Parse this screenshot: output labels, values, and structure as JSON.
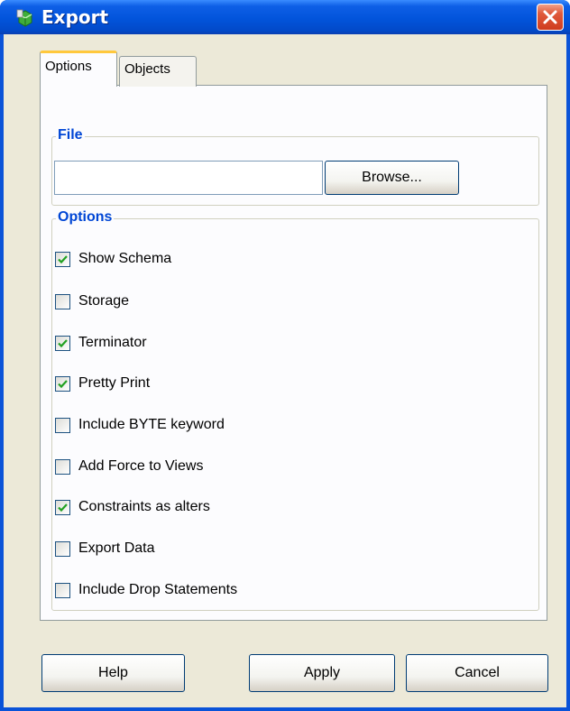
{
  "window": {
    "title": "Export"
  },
  "tabs": [
    {
      "label": "Options",
      "selected": true
    },
    {
      "label": "Objects",
      "selected": false
    }
  ],
  "file_group": {
    "legend": "File",
    "path_value": "",
    "browse_label": "Browse..."
  },
  "options_group": {
    "legend": "Options",
    "items": [
      {
        "label": "Show Schema",
        "checked": true
      },
      {
        "label": "Storage",
        "checked": false
      },
      {
        "label": "Terminator",
        "checked": true
      },
      {
        "label": "Pretty Print",
        "checked": true
      },
      {
        "label": "Include BYTE keyword",
        "checked": false
      },
      {
        "label": "Add Force to Views",
        "checked": false
      },
      {
        "label": "Constraints as alters",
        "checked": true
      },
      {
        "label": "Export Data",
        "checked": false
      },
      {
        "label": "Include Drop Statements",
        "checked": false
      }
    ]
  },
  "buttons": {
    "help": "Help",
    "apply": "Apply",
    "cancel": "Cancel"
  },
  "colors": {
    "title_bar": "#0254DB",
    "dialog_bg": "#ECE9D8",
    "legend_text": "#0046D5",
    "close_button": "#E05A3C"
  }
}
